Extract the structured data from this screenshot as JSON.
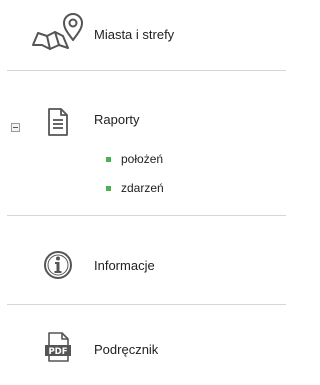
{
  "menu": {
    "items": [
      {
        "label": "Miasta i strefy",
        "icon": "map-pin-icon"
      },
      {
        "label": "Raporty",
        "icon": "document-icon",
        "expanded": true,
        "toggle_icon": "collapse-minus-icon",
        "subitems": [
          {
            "label": "położeń"
          },
          {
            "label": "zdarzeń"
          }
        ]
      },
      {
        "label": "Informacje",
        "icon": "info-icon"
      },
      {
        "label": "Podręcznik",
        "icon": "pdf-icon",
        "icon_text": "PDF"
      }
    ]
  },
  "colors": {
    "bullet": "#4caf50",
    "divider": "#d6d6d6",
    "icon": "#555555"
  }
}
